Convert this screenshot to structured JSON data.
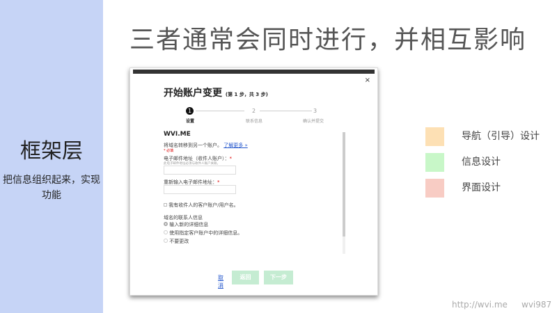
{
  "slide": {
    "title": "三者通常会同时进行，并相互影响",
    "layer_title": "框架层",
    "layer_desc": "把信息组织起来，实现功能"
  },
  "dialog": {
    "close": "×",
    "heading": "开始账户变更",
    "step_info": "(第 1 步，共 3 步)",
    "steps": [
      {
        "num": "1",
        "label": "设置"
      },
      {
        "num": "2",
        "label": "联系信息"
      },
      {
        "num": "3",
        "label": "确认并提交"
      }
    ],
    "domain": "WVI.ME",
    "transfer_text": "将域名转移到另一个账户。",
    "learn_more": "了解更多 »",
    "required_note": "* 必填",
    "email_label": "电子邮件地址（收件人账户）：",
    "email_hint": "此电子邮件地址必须与收件人账户关联。",
    "email_value": "",
    "reenter_label": "重新输入电子邮件地址：",
    "reenter_value": "",
    "asterisk": "*",
    "checkbox_label": "我有收件人的客户账户/用户名。",
    "contact_heading": "域名的联系人信息",
    "radios": [
      "输入新的详细信息",
      "使用指定客户账户中的详细信息。",
      "不要更改"
    ],
    "cancel": "取消",
    "back": "返回",
    "next": "下一步"
  },
  "legend": [
    {
      "label": "导航（引导）设计",
      "color": "#fde0b4"
    },
    {
      "label": "信息设计",
      "color": "#c8f7c8"
    },
    {
      "label": "界面设计",
      "color": "#f8ccc4"
    }
  ],
  "footer": {
    "url": "http://wvi.me",
    "author": "wvi987"
  }
}
